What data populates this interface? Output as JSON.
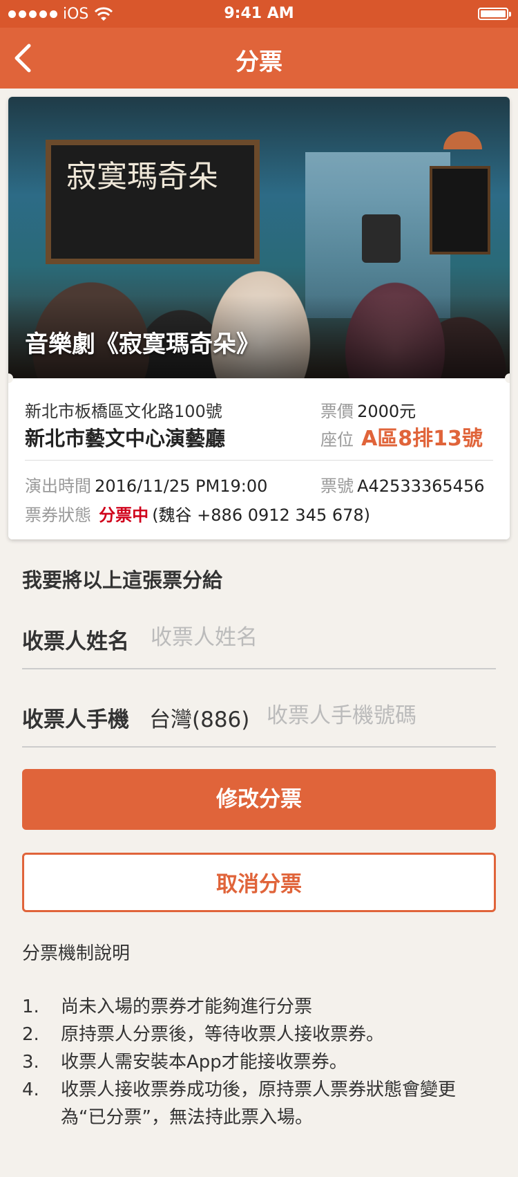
{
  "status_bar": {
    "carrier": "iOS",
    "time": "9:41 AM"
  },
  "nav": {
    "title": "分票"
  },
  "ticket": {
    "show_title": "音樂劇《寂寞瑪奇朵》",
    "poster_board_text": "寂寞瑪奇朵",
    "address": "新北市板橋區文化路100號",
    "venue": "新北市藝文中心演藝廳",
    "price_label": "票價",
    "price_value": "2000元",
    "seat_label": "座位",
    "seat_value": "A區8排13號",
    "time_label": "演出時間",
    "time_value": "2016/11/25 PM19:00",
    "ticket_no_label": "票號",
    "ticket_no_value": "A42533365456",
    "status_label": "票券狀態",
    "status_value": "分票中",
    "status_detail": "(魏谷 +886 0912 345 678)"
  },
  "form": {
    "section_title": "我要將以上這張票分給",
    "name_label": "收票人姓名",
    "name_placeholder": "收票人姓名",
    "phone_label": "收票人手機",
    "country_code": "台灣(886)",
    "phone_placeholder": "收票人手機號碼"
  },
  "buttons": {
    "modify": "修改分票",
    "cancel": "取消分票"
  },
  "rules": {
    "title": "分票機制說明",
    "items": [
      {
        "num": "1.",
        "text": "尚未入場的票券才能夠進行分票"
      },
      {
        "num": "2.",
        "text": "原持票人分票後，等待收票人接收票券。"
      },
      {
        "num": "3.",
        "text": "收票人需安裝本App才能接收票券。"
      },
      {
        "num": "4.",
        "text": "收票人接收票券成功後，原持票人票券狀態會變更為“已分票”，無法持此票入場。"
      }
    ]
  },
  "colors": {
    "brand": "#e0643a",
    "status_red": "#d0021b"
  }
}
